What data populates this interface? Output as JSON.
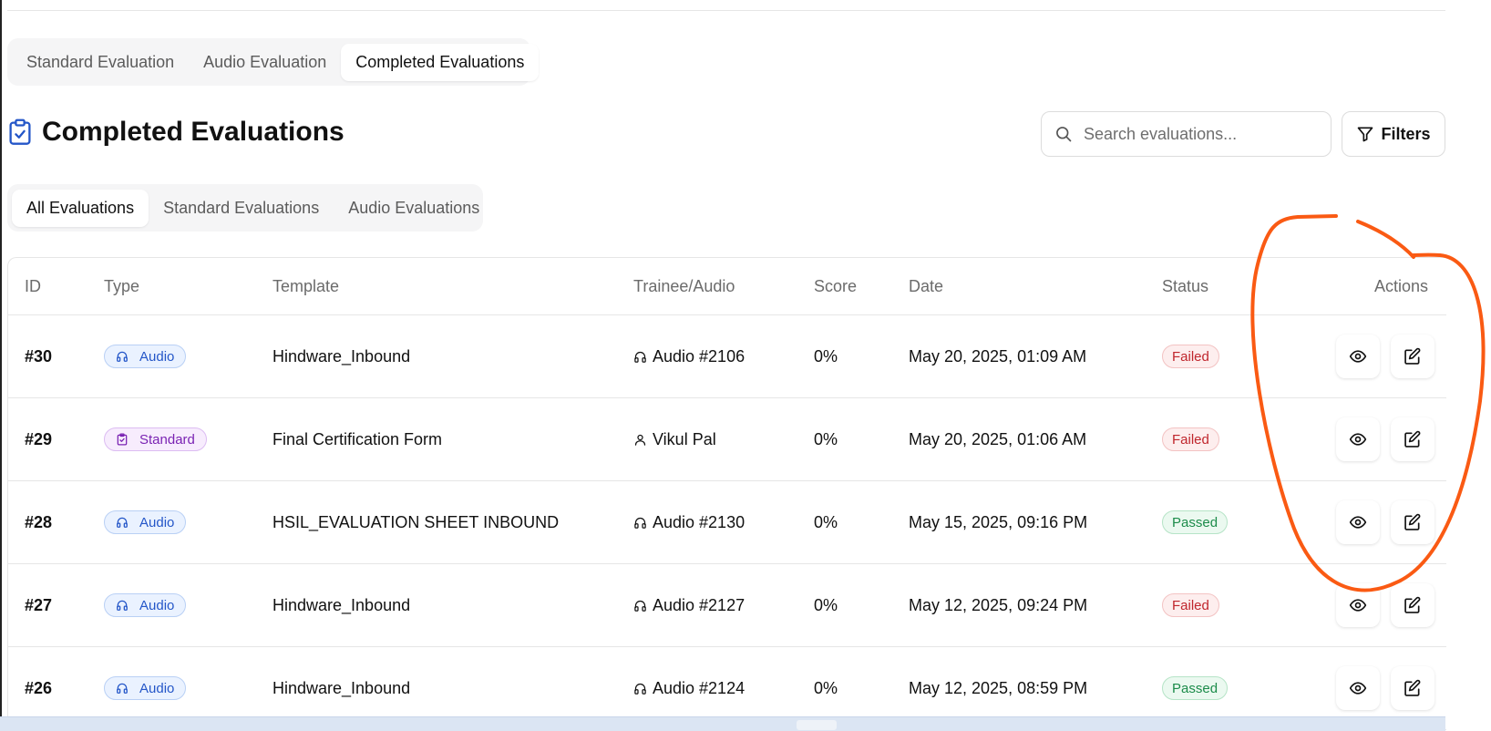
{
  "top_tabs": [
    {
      "label": "Standard Evaluation",
      "active": false
    },
    {
      "label": "Audio Evaluation",
      "active": false
    },
    {
      "label": "Completed Evaluations",
      "active": true
    }
  ],
  "page_title": "Completed Evaluations",
  "search": {
    "placeholder": "Search evaluations..."
  },
  "filters_label": "Filters",
  "sub_tabs": [
    {
      "label": "All Evaluations",
      "active": true
    },
    {
      "label": "Standard Evaluations",
      "active": false
    },
    {
      "label": "Audio Evaluations",
      "active": false
    }
  ],
  "table": {
    "headers": {
      "id": "ID",
      "type": "Type",
      "template": "Template",
      "trainee": "Trainee/Audio",
      "score": "Score",
      "date": "Date",
      "status": "Status",
      "actions": "Actions"
    },
    "rows": [
      {
        "id": "#30",
        "type": "Audio",
        "template": "Hindware_Inbound",
        "trainee": "Audio #2106",
        "score": "0%",
        "date": "May 20, 2025, 01:09 AM",
        "status": "Failed"
      },
      {
        "id": "#29",
        "type": "Standard",
        "template": "Final Certification Form",
        "trainee": "Vikul Pal",
        "score": "0%",
        "date": "May 20, 2025, 01:06 AM",
        "status": "Failed"
      },
      {
        "id": "#28",
        "type": "Audio",
        "template": "HSIL_EVALUATION SHEET INBOUND",
        "trainee": "Audio #2130",
        "score": "0%",
        "date": "May 15, 2025, 09:16 PM",
        "status": "Passed"
      },
      {
        "id": "#27",
        "type": "Audio",
        "template": "Hindware_Inbound",
        "trainee": "Audio #2127",
        "score": "0%",
        "date": "May 12, 2025, 09:24 PM",
        "status": "Failed"
      },
      {
        "id": "#26",
        "type": "Audio",
        "template": "Hindware_Inbound",
        "trainee": "Audio #2124",
        "score": "0%",
        "date": "May 12, 2025, 08:59 PM",
        "status": "Passed"
      }
    ]
  },
  "icons": {
    "title": "clipboard-check-icon",
    "search": "search-icon",
    "filters": "funnel-icon",
    "audio": "headphones-icon",
    "standard": "clipboard-icon",
    "trainee": "user-icon",
    "view": "eye-icon",
    "edit": "edit-icon"
  },
  "colors": {
    "accent": "#2456c8",
    "failed": "#c0262d",
    "passed": "#1c8c4a",
    "standard": "#7a23b3",
    "annotation": "#fa5a13"
  }
}
